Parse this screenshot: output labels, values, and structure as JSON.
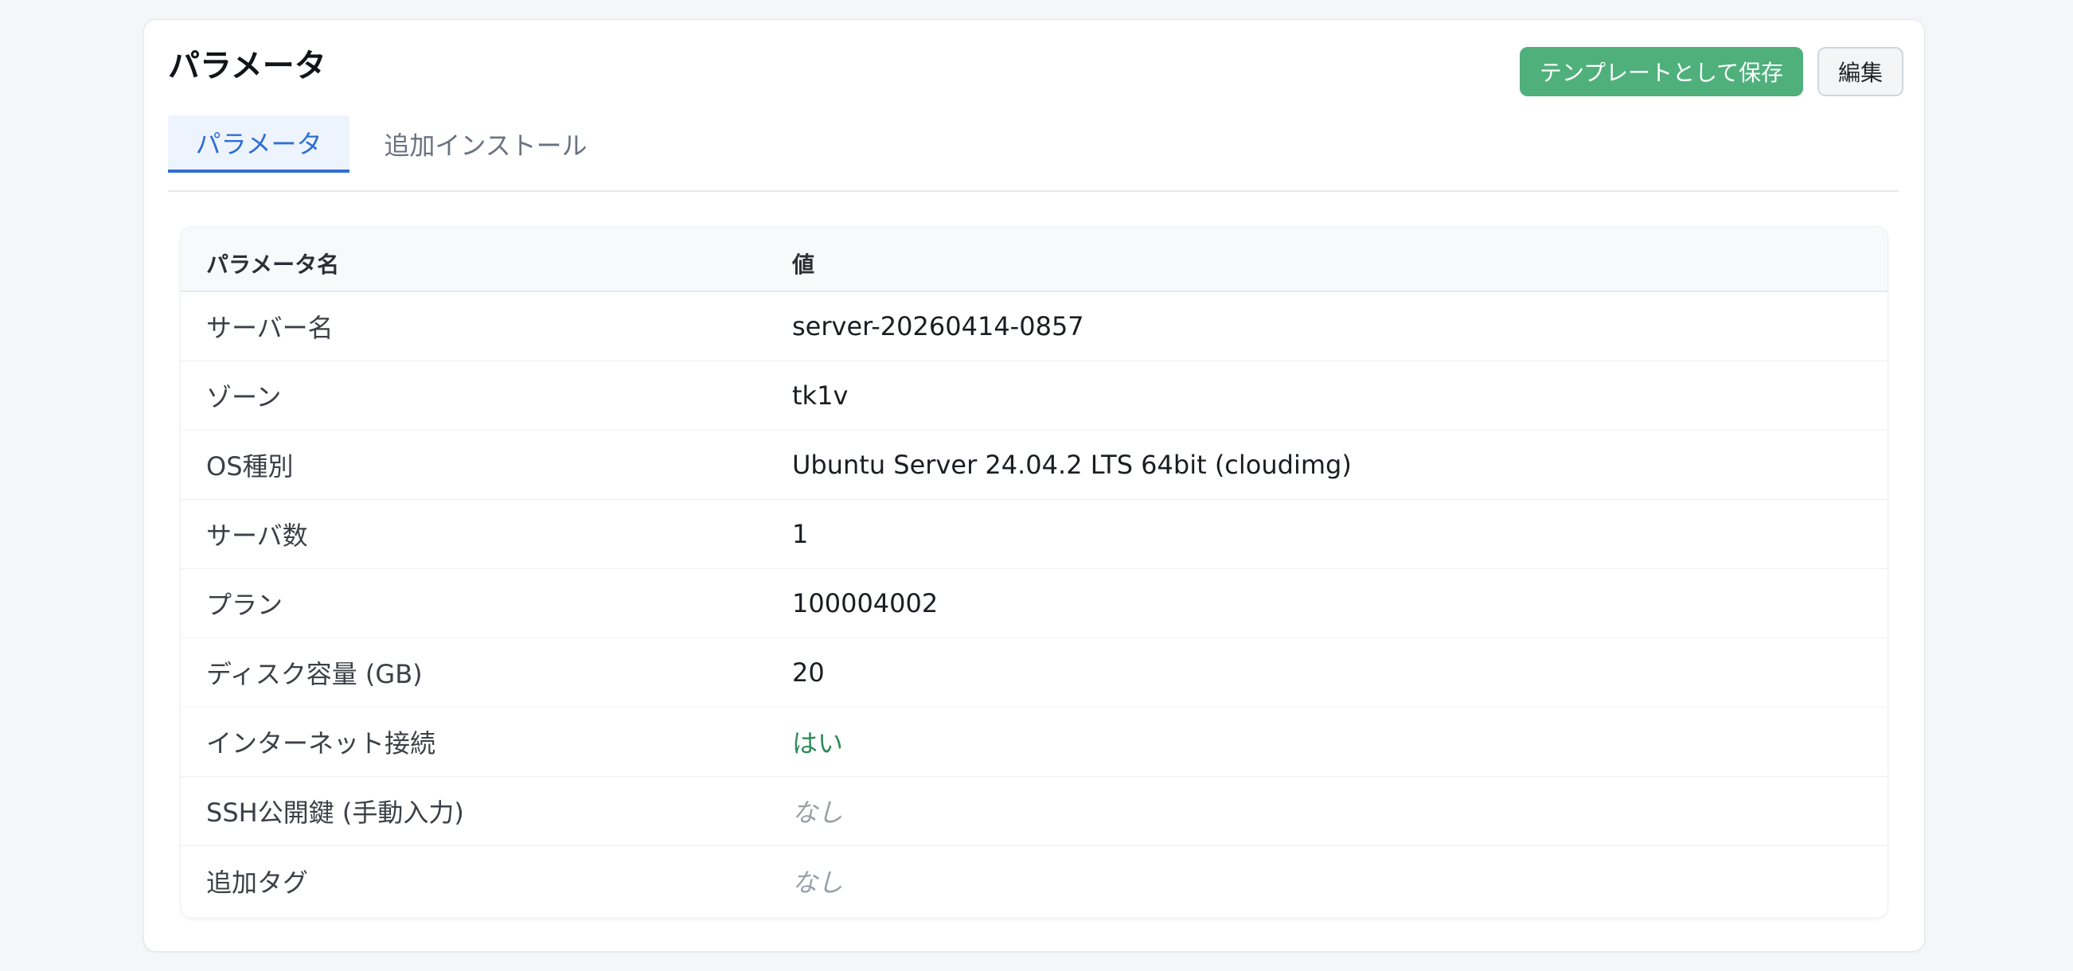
{
  "page": {
    "title": "パラメータ"
  },
  "tabs": [
    {
      "label": "パラメータ",
      "active": true
    },
    {
      "label": "追加インストール",
      "active": false
    }
  ],
  "actions": {
    "save_template_label": "テンプレートとして保存",
    "edit_label": "編集"
  },
  "colors": {
    "accent": "#2f6fd3",
    "save_button": "#4fb07c",
    "yes_text": "#2f8a5a",
    "none_text": "#9aa0a6"
  },
  "table": {
    "headers": [
      "パラメータ名",
      "値"
    ],
    "rows": [
      {
        "name": "サーバー名",
        "value": "server-20260414-0857",
        "style": "normal"
      },
      {
        "name": "ゾーン",
        "value": "tk1v",
        "style": "normal"
      },
      {
        "name": "OS種別",
        "value": "Ubuntu Server 24.04.2 LTS 64bit (cloudimg)",
        "style": "normal"
      },
      {
        "name": "サーバ数",
        "value": "1",
        "style": "normal"
      },
      {
        "name": "プラン",
        "value": "100004002",
        "style": "normal"
      },
      {
        "name": "ディスク容量 (GB)",
        "value": "20",
        "style": "normal"
      },
      {
        "name": "インターネット接続",
        "value": "はい",
        "style": "yes"
      },
      {
        "name": "SSH公開鍵 (手動入力)",
        "value": "なし",
        "style": "none"
      },
      {
        "name": "追加タグ",
        "value": "なし",
        "style": "none"
      }
    ]
  }
}
